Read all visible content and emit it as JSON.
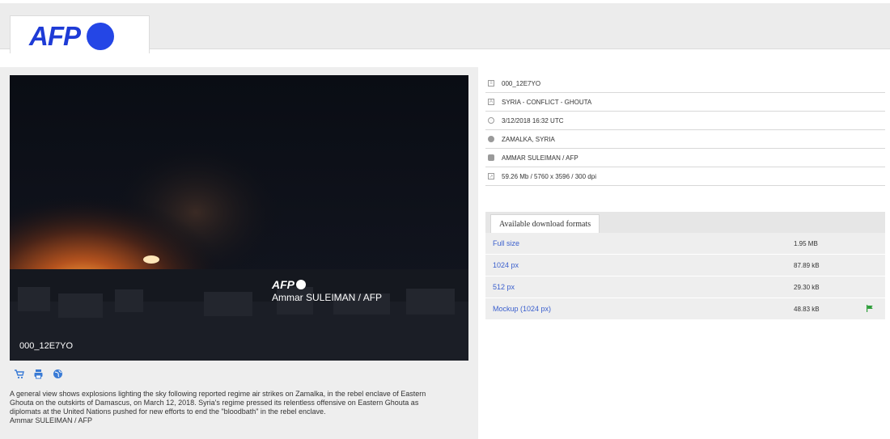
{
  "header": {
    "logo": {
      "text": "AFP",
      "icon": "afp-dot-icon",
      "color": "#1e3bd6"
    }
  },
  "photo": {
    "watermark_logo": "AFP",
    "watermark_credit": "Ammar SULEIMAN / AFP",
    "id_overlay": "000_12E7YO",
    "actions": [
      {
        "name": "cart-icon"
      },
      {
        "name": "print-icon"
      },
      {
        "name": "globe-icon"
      }
    ],
    "caption_lines": [
      "A general view shows explosions lighting the sky following reported regime air strikes on Zamalka, in the rebel enclave of Eastern",
      "Ghouta on the outskirts of Damascus, on March 12, 2018. Syria's regime pressed its relentless offensive on Eastern Ghouta as",
      "diplomats at the United Nations pushed for new efforts to end the \"bloodbath\" in the rebel enclave.",
      "Ammar SULEIMAN / AFP"
    ]
  },
  "meta": [
    {
      "icon": "document-icon",
      "value": "000_12E7YO"
    },
    {
      "icon": "title-icon",
      "value": "SYRIA - CONFLICT - GHOUTA"
    },
    {
      "icon": "clock-icon",
      "value": "3/12/2018 16:32 UTC"
    },
    {
      "icon": "globe-icon",
      "value": "ZAMALKA, SYRIA"
    },
    {
      "icon": "camera-icon",
      "value": "AMMAR SULEIMAN / AFP"
    },
    {
      "icon": "resize-icon",
      "value": "59.26 Mb / 5760 x 3596 / 300 dpi"
    }
  ],
  "formats": {
    "tab_label": "Available download formats",
    "rows": [
      {
        "label": "Full size",
        "size": "1.95 MB"
      },
      {
        "label": "1024 px",
        "size": "87.89 kB"
      },
      {
        "label": "512 px",
        "size": "29.30 kB"
      },
      {
        "label": "Mockup (1024 px)",
        "size": "48.83 kB",
        "icon": "flag-icon"
      }
    ]
  },
  "colors": {
    "link": "#3a5fcd",
    "accent": "#2446e6",
    "flag": "#2e9e3a"
  }
}
